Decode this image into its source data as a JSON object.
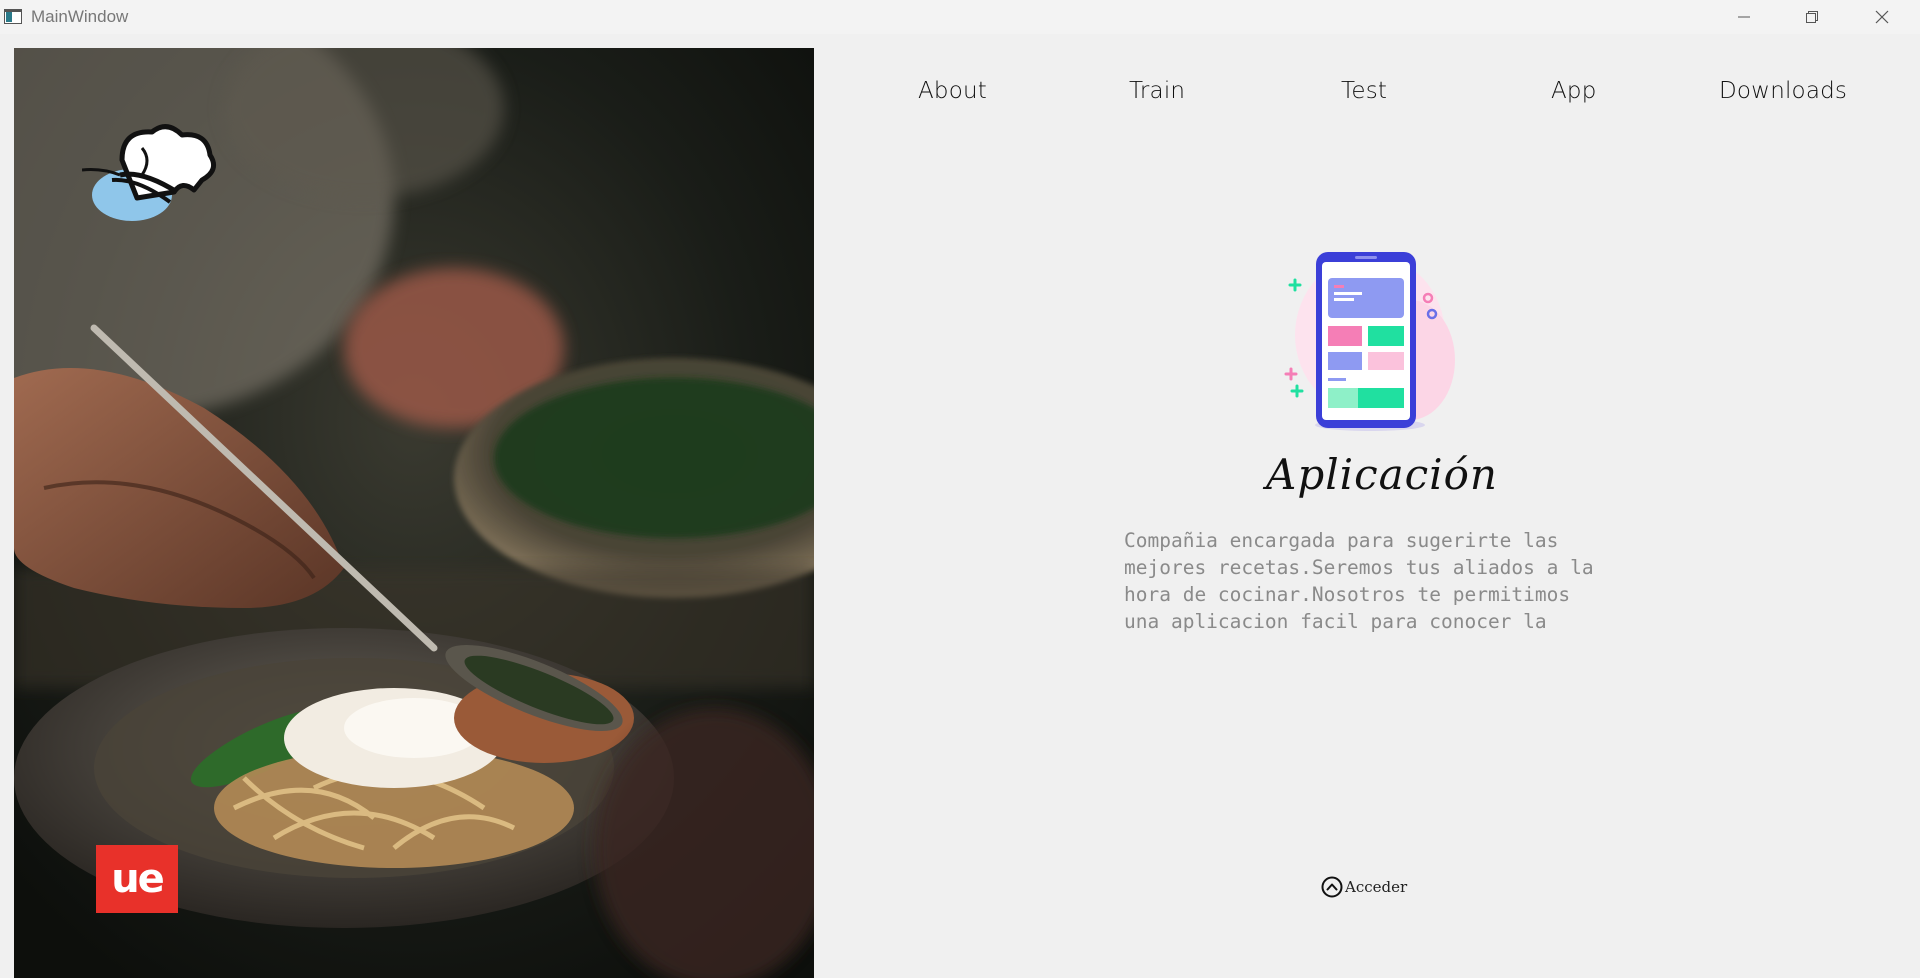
{
  "window": {
    "title": "MainWindow"
  },
  "nav": {
    "items": [
      "About",
      "Train",
      "Test",
      "App",
      "Downloads"
    ]
  },
  "main": {
    "title": "Aplicación",
    "description": "Compañia encargada para sugerirte las\nmejores recetas.Seremos tus aliados a la\nhora de cocinar.Nosotros te permitimos\nuna aplicacion facil para conocer la",
    "access_label": "Acceder"
  },
  "logos": {
    "brand_badge": "ue"
  },
  "colors": {
    "background": "#f0f0f0",
    "badge_red": "#e8312a",
    "phone_blue": "#3b3fd8",
    "accent_green": "#20e0a0",
    "accent_pink": "#f57eb6"
  },
  "icons": {
    "app_icon": "window-icon",
    "minimize": "minimize-icon",
    "maximize": "restore-icon",
    "close": "close-icon",
    "chef_logo": "chef-hat-icon",
    "access": "chevron-up-circle-icon"
  }
}
